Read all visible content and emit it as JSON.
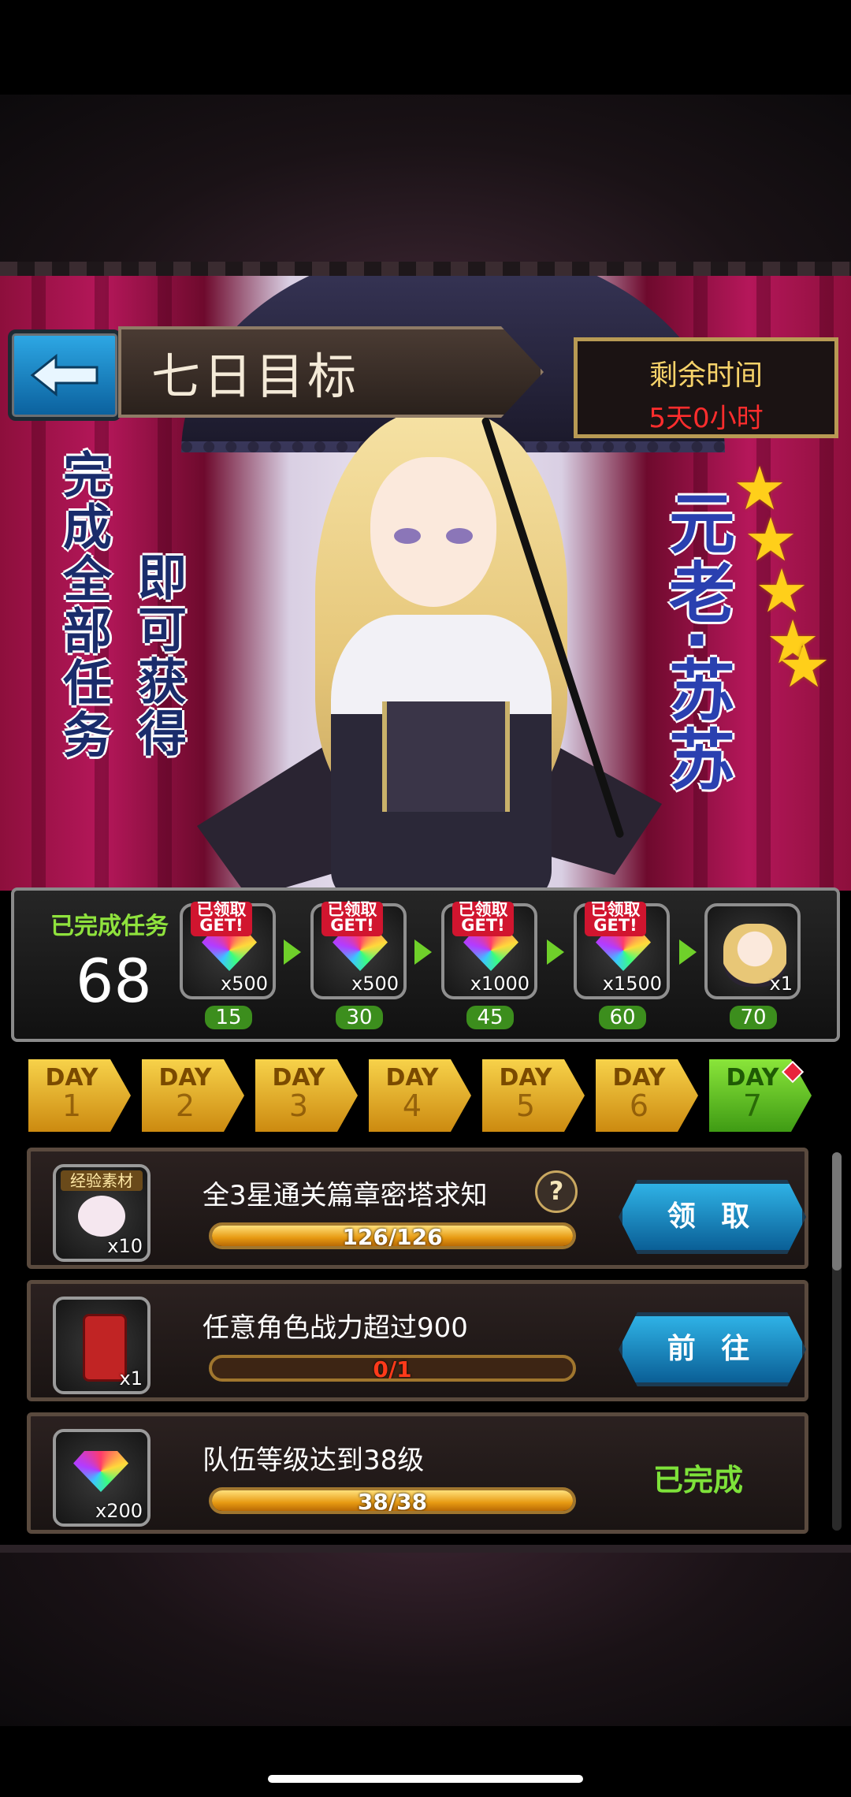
{
  "header": {
    "title": "七日目标",
    "timer_label": "剩余时间",
    "timer_value": "5天0小时"
  },
  "banner": {
    "promo_col1": "完成全部任务",
    "promo_col2": "即可获得",
    "hero_name": "元老·苏苏",
    "hero_stars": 5
  },
  "progress": {
    "completed_label": "已完成任务",
    "completed_count": "68",
    "rewards": [
      {
        "badge": "已领取 GET!",
        "qty": "x500",
        "milestone": "15",
        "icon": "rainbow-gem-icon"
      },
      {
        "badge": "已领取 GET!",
        "qty": "x500",
        "milestone": "30",
        "icon": "rainbow-gem-icon"
      },
      {
        "badge": "已领取 GET!",
        "qty": "x1000",
        "milestone": "45",
        "icon": "rainbow-gem-icon"
      },
      {
        "badge": "已领取 GET!",
        "qty": "x1500",
        "milestone": "60",
        "icon": "rainbow-gem-icon"
      },
      {
        "badge": "",
        "qty": "x1",
        "milestone": "70",
        "icon": "hero-portrait-icon"
      }
    ]
  },
  "days": [
    {
      "label": "DAY",
      "num": "1"
    },
    {
      "label": "DAY",
      "num": "2"
    },
    {
      "label": "DAY",
      "num": "3"
    },
    {
      "label": "DAY",
      "num": "4"
    },
    {
      "label": "DAY",
      "num": "5"
    },
    {
      "label": "DAY",
      "num": "6"
    },
    {
      "label": "DAY",
      "num": "7"
    }
  ],
  "tasks": [
    {
      "title": "全3星通关篇章密塔求知",
      "progress_text": "126/126",
      "progress": 1.0,
      "icon_qty": "x10",
      "icon_label": "经验素材",
      "action": "领 取",
      "status": ""
    },
    {
      "title": "任意角色战力超过900",
      "progress_text": "0/1",
      "progress": 0.0,
      "icon_qty": "x1",
      "icon_label": "",
      "action": "前 往",
      "status": ""
    },
    {
      "title": "队伍等级达到38级",
      "progress_text": "38/38",
      "progress": 1.0,
      "icon_qty": "x200",
      "icon_label": "",
      "action": "",
      "status": "已完成"
    }
  ],
  "colors": {
    "accent_blue": "#1a8fd0",
    "gold": "#f7d24a",
    "green": "#7ee23a",
    "timer_red": "#ff2d2d"
  }
}
